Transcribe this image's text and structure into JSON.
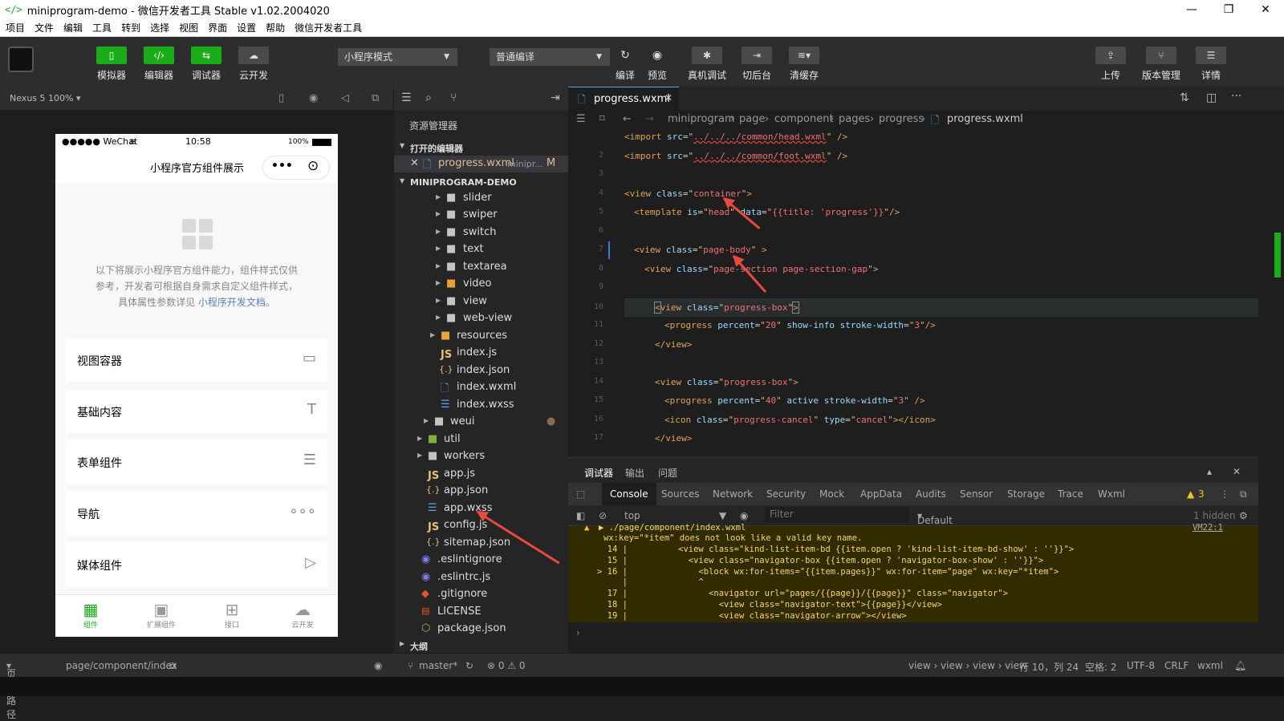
{
  "window": {
    "title": "miniprogram-demo - 微信开发者工具 Stable v1.02.2004020",
    "logo": "</>"
  },
  "menu": [
    "项目",
    "文件",
    "编辑",
    "工具",
    "转到",
    "选择",
    "视图",
    "界面",
    "设置",
    "帮助",
    "微信开发者工具"
  ],
  "toolbar": {
    "simulator": "模拟器",
    "editor": "编辑器",
    "debugger": "调试器",
    "cloud": "云开发",
    "mode": "小程序模式",
    "compile": "普通编译",
    "compile_btn": "编译",
    "preview": "预览",
    "real_debug": "真机调试",
    "switch_bg": "切后台",
    "clear_cache": "清缓存",
    "upload": "上传",
    "version": "版本管理",
    "details": "详情"
  },
  "simulator": {
    "device": "Nexus 5 100%",
    "status_carrier": "●●●●● WeChat",
    "status_time": "10:58",
    "status_battery": "100%",
    "nav_title": "小程序官方组件展示",
    "desc_line1": "以下将展示小程序官方组件能力，组件样式仅供",
    "desc_line2": "参考，开发者可根据自身需求自定义组件样式，",
    "desc_line3": "具体属性参数详见",
    "desc_link": "小程序开发文档",
    "desc_end": "。",
    "cards": [
      "视图容器",
      "基础内容",
      "表单组件",
      "导航",
      "媒体组件"
    ],
    "tabs": [
      "组件",
      "扩展组件",
      "接口",
      "云开发"
    ]
  },
  "explorer": {
    "title": "资源管理器",
    "open_editors": "打开的编辑器",
    "open_file": "progress.wxml",
    "open_file_path": "minipr...",
    "open_file_status": "M",
    "project": "MINIPROGRAM-DEMO",
    "outline": "大纲",
    "files": [
      "slider",
      "swiper",
      "switch",
      "text",
      "textarea",
      "video",
      "view",
      "web-view",
      "resources",
      "index.js",
      "index.json",
      "index.wxml",
      "index.wxss",
      "weui",
      "util",
      "workers",
      "app.js",
      "app.json",
      "app.wxss",
      "config.js",
      "sitemap.json",
      ".eslintignore",
      ".eslintrc.js",
      ".gitignore",
      "LICENSE",
      "package.json"
    ]
  },
  "editor": {
    "tab": "progress.wxml",
    "crumbs": [
      "miniprogram",
      "page",
      "component",
      "pages",
      "progress",
      "progress.wxml"
    ]
  },
  "debugger": {
    "tabs_top": [
      "调试器",
      "输出",
      "问题"
    ],
    "tabs": [
      "Console",
      "Sources",
      "Network",
      "Security",
      "Mock",
      "AppData",
      "Audits",
      "Sensor",
      "Storage",
      "Trace",
      "Wxml"
    ],
    "warn_count": "3",
    "context": "top",
    "filter_placeholder": "Filter",
    "levels": "Default levels",
    "hidden": "1 hidden",
    "warn_path": "▶ ./page/component/index.wxml",
    "warn_ref": "VM22:1",
    "warn_msg": "wx:key=\"*item\" does not look like a valid key name.",
    "lines": [
      "  14 |          <view class=\"kind-list-item-bd {{item.open ? 'kind-list-item-bd-show' : ''}}\">",
      "  15 |            <view class=\"navigator-box {{item.open ? 'navigator-box-show' : ''}}\">",
      "> 16 |              <block wx:for-items=\"{{item.pages}}\" wx:for-item=\"page\" wx:key=\"*item\">",
      "     |              ^",
      "  17 |                <navigator url=\"pages/{{page}}/{{page}}\" class=\"navigator\">",
      "  18 |                  <view class=\"navigator-text\">{{page}}</view>",
      "  19 |                  <view class=\"navigator-arrow\"></view>"
    ]
  },
  "statusbar": {
    "path_label": "页面路径",
    "path": "page/component/index",
    "branch": "master*",
    "problems": "⊗ 0 ⚠ 0",
    "crumb": "view › view › view › view",
    "pos": "行 10，列 24",
    "spaces": "空格: 2",
    "encoding": "UTF-8",
    "eol": "CRLF",
    "lang": "wxml"
  }
}
